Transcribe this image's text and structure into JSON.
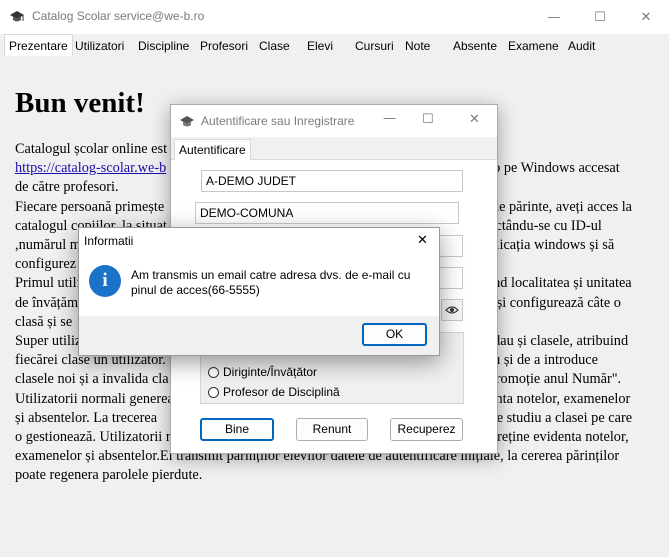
{
  "window": {
    "title": "Catalog Scolar service@we-b.ro",
    "minimize_glyph": "—",
    "maximize_glyph": "☐",
    "close_glyph": "✕"
  },
  "tabs": [
    "Prezentare",
    "Utilizatori",
    "Discipline",
    "Profesori",
    "Clase",
    "Elevi",
    "Cursuri",
    "Note",
    "Absente",
    "Examene",
    "Audit"
  ],
  "page": {
    "heading": "Bun venit!",
    "p1_a": "Catalogul școlar online est",
    "p1_link": "https://catalog-scolar.we-b",
    "p1_b": "top pe Windows accesat",
    "p1_c": "de către profesori.",
    "p2_a": "Fiecare persoană primește",
    "p2_b": "e de părinte, aveți acces la",
    "p3_a": "catalogul copiilor, la situaț",
    "p3_b": "nectându-se cu ID-ul",
    "p4_a": ",numărul m",
    "p4_b": "aplicația windows și să",
    "p5_a": "configurez",
    "p6_a": "Primul utili",
    "p6_b": "rând localitatea și unitatea",
    "p7_a": "de învățăm",
    "p7_b": "in și configurează câte o",
    "p8_a": "clasă și se",
    "p9_a": "Super utiliz",
    "p9_b": "redau și clasele, atribuind",
    "p10_a": "fiecărei clase un utilizator.",
    "p10_b": "diu și de a introduce",
    "p11_a": "clasele noi și a invalida cla",
    "p11_b": "\"Promoție anul Număr\".",
    "p12_a": "Utilizatorii normali generea",
    "p12_b": "denta notelor, examenelor",
    "p13_a": "și absentelor. La trecerea",
    "p13_b": "l de studiu a clasei pe care",
    "p14_a": "o gestionează. Utilizatorii r",
    "p14_b": "întreține evidenta notelor,",
    "p15": "examenelor și absentelor.Ei transmit părinților elevilor datele de autentificare inițiale, la cererea părinților",
    "p16": "poate regenera parolele pierdute."
  },
  "auth_dialog": {
    "title": "Autentificare sau Inregistrare",
    "tab": "Autentificare",
    "field_judet": "A-DEMO JUDET",
    "field_comuna": "DEMO-COMUNA",
    "radio_diriginte": "Diriginte/Învățător",
    "radio_profesor": "Profesor de Disciplină",
    "btn_bine": "Bine",
    "btn_renunt": "Renunt",
    "btn_recuperez": "Recuperez"
  },
  "info_dialog": {
    "title": "Informatii",
    "message_line1": "Am transmis un email catre adresa dvs. de e-mail cu",
    "message_line2": "pinul de acces(66-5555)",
    "ok_label": "OK",
    "icon_glyph": "i"
  }
}
